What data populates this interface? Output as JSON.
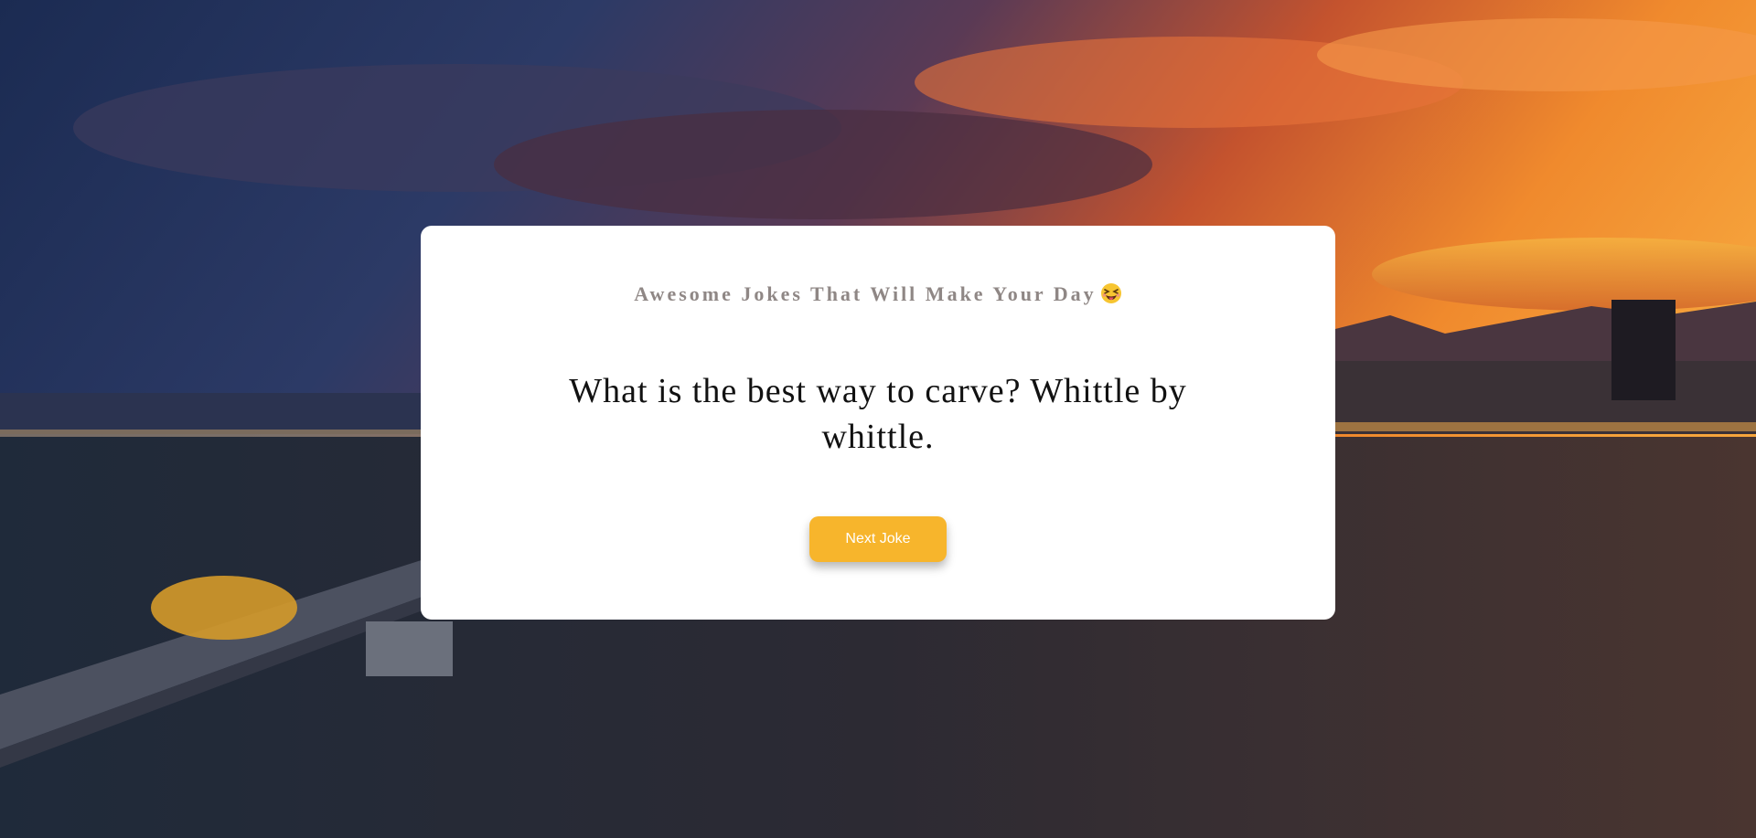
{
  "app": {
    "heading": "Awesome Jokes That Will Make Your Day",
    "heading_emoji": "squinting-face-with-tongue-icon",
    "joke": "What is the best way to carve? Whittle by whittle.",
    "next_button_label": "Next Joke"
  },
  "colors": {
    "button": "#f7b52c",
    "heading": "#8f8785",
    "card": "#ffffff"
  }
}
